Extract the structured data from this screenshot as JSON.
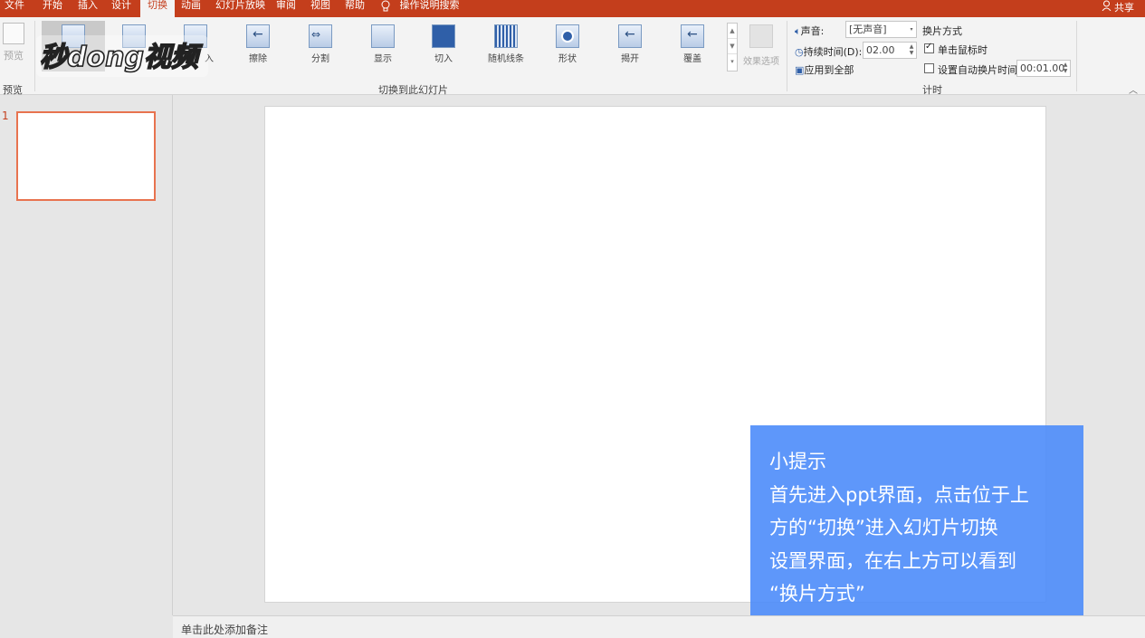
{
  "menu": {
    "tabs": [
      "文件",
      "开始",
      "插入",
      "设计",
      "切换",
      "动画",
      "幻灯片放映",
      "审阅",
      "视图",
      "帮助"
    ],
    "active_tab": "切换",
    "tell_me": "操作说明搜索",
    "share": "共享"
  },
  "ribbon": {
    "preview": {
      "label": "预览",
      "group": "预览"
    },
    "transitions": {
      "group_label": "切换到此幻灯片",
      "items": [
        "",
        "",
        "入",
        "擦除",
        "分割",
        "显示",
        "切入",
        "随机线条",
        "形状",
        "揭开",
        "覆盖"
      ]
    },
    "effect_options": "效果选项",
    "timing": {
      "group_label": "计时",
      "sound_label": "声音:",
      "sound_value": "[无声音]",
      "duration_label": "持续时间(D):",
      "duration_value": "02.00",
      "apply_all": "应用到全部",
      "advance_title": "换片方式",
      "on_click_label": "单击鼠标时",
      "on_click_checked": true,
      "after_label": "设置自动换片时间:",
      "after_checked": false,
      "after_value": "00:01.00"
    }
  },
  "thumbnails": {
    "slide_number": "1"
  },
  "notes": {
    "placeholder": "单击此处添加备注"
  },
  "tip": {
    "title": "小提示",
    "lines": [
      "首先进入ppt界面，点击位于上",
      "方的“切换”进入幻灯片切换",
      "设置界面，在右上方可以看到",
      "“换片方式”"
    ]
  },
  "logo": {
    "text": "秒dong视频"
  },
  "colors": {
    "accent": "#c43e1c",
    "tip_bg": "#4d8cfa",
    "thumb_border": "#e8734f"
  }
}
